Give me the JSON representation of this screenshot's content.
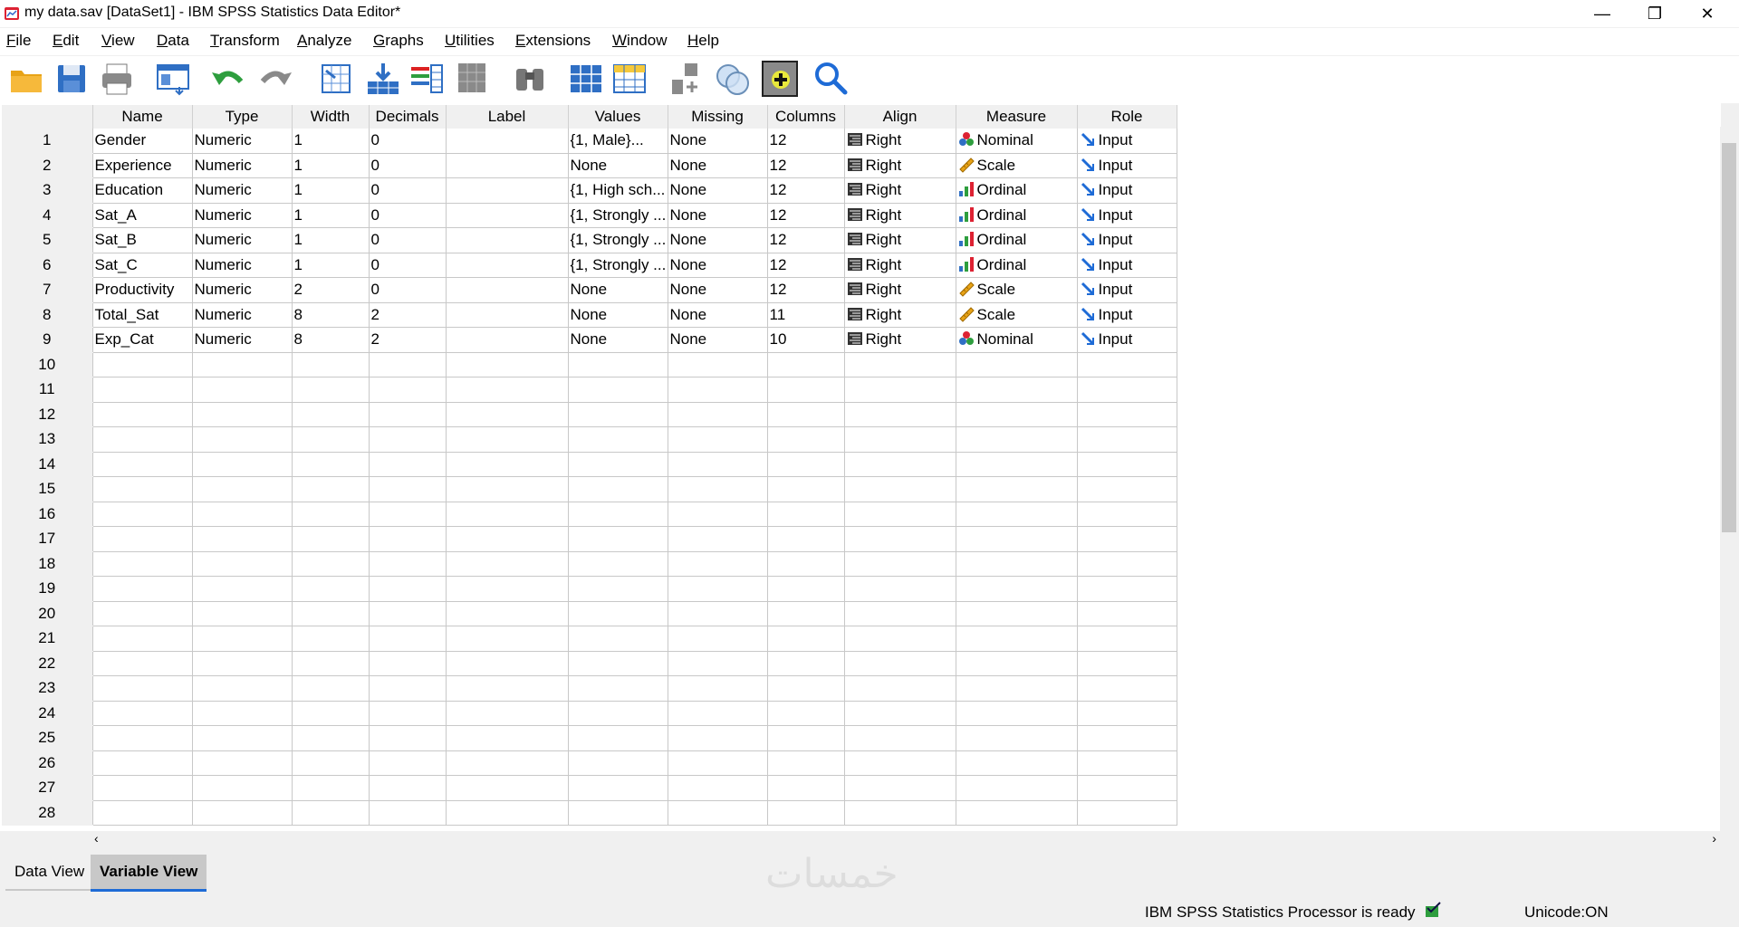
{
  "window": {
    "title": "my data.sav [DataSet1] - IBM SPSS Statistics Data Editor*",
    "minimize_glyph": "—",
    "restore_glyph": "❐",
    "close_glyph": "✕"
  },
  "menu": [
    "File",
    "Edit",
    "View",
    "Data",
    "Transform",
    "Analyze",
    "Graphs",
    "Utilities",
    "Extensions",
    "Window",
    "Help"
  ],
  "toolbar": {
    "icons": [
      "open-folder-icon",
      "save-icon",
      "print-icon",
      "dialog-recall-icon",
      "undo-icon",
      "redo-icon",
      "goto-case-icon",
      "goto-variable-icon",
      "variables-icon",
      "run-descriptives-icon",
      "find-icon",
      "insert-cases-icon",
      "insert-variable-icon",
      "split-file-icon",
      "select-cases-icon",
      "value-labels-icon",
      "use-variable-sets-icon",
      "search-icon"
    ]
  },
  "grid": {
    "columns": [
      "Name",
      "Type",
      "Width",
      "Decimals",
      "Label",
      "Values",
      "Missing",
      "Columns",
      "Align",
      "Measure",
      "Role"
    ],
    "rows": [
      {
        "num": "1",
        "name": "Gender",
        "type": "Numeric",
        "width": "1",
        "decimals": "0",
        "label": "",
        "values": "{1, Male}...",
        "missing": "None",
        "columns": "12",
        "align": "Right",
        "measure": "Nominal",
        "role": "Input"
      },
      {
        "num": "2",
        "name": "Experience",
        "type": "Numeric",
        "width": "1",
        "decimals": "0",
        "label": "",
        "values": "None",
        "missing": "None",
        "columns": "12",
        "align": "Right",
        "measure": "Scale",
        "role": "Input"
      },
      {
        "num": "3",
        "name": "Education",
        "type": "Numeric",
        "width": "1",
        "decimals": "0",
        "label": "",
        "values": "{1, High sch...",
        "missing": "None",
        "columns": "12",
        "align": "Right",
        "measure": "Ordinal",
        "role": "Input"
      },
      {
        "num": "4",
        "name": "Sat_A",
        "type": "Numeric",
        "width": "1",
        "decimals": "0",
        "label": "",
        "values": "{1, Strongly ...",
        "missing": "None",
        "columns": "12",
        "align": "Right",
        "measure": "Ordinal",
        "role": "Input"
      },
      {
        "num": "5",
        "name": "Sat_B",
        "type": "Numeric",
        "width": "1",
        "decimals": "0",
        "label": "",
        "values": "{1, Strongly ...",
        "missing": "None",
        "columns": "12",
        "align": "Right",
        "measure": "Ordinal",
        "role": "Input"
      },
      {
        "num": "6",
        "name": "Sat_C",
        "type": "Numeric",
        "width": "1",
        "decimals": "0",
        "label": "",
        "values": "{1, Strongly ...",
        "missing": "None",
        "columns": "12",
        "align": "Right",
        "measure": "Ordinal",
        "role": "Input"
      },
      {
        "num": "7",
        "name": "Productivity",
        "type": "Numeric",
        "width": "2",
        "decimals": "0",
        "label": "",
        "values": "None",
        "missing": "None",
        "columns": "12",
        "align": "Right",
        "measure": "Scale",
        "role": "Input"
      },
      {
        "num": "8",
        "name": "Total_Sat",
        "type": "Numeric",
        "width": "8",
        "decimals": "2",
        "label": "",
        "values": "None",
        "missing": "None",
        "columns": "11",
        "align": "Right",
        "measure": "Scale",
        "role": "Input"
      },
      {
        "num": "9",
        "name": "Exp_Cat",
        "type": "Numeric",
        "width": "8",
        "decimals": "2",
        "label": "",
        "values": "None",
        "missing": "None",
        "columns": "10",
        "align": "Right",
        "measure": "Nominal",
        "role": "Input"
      }
    ],
    "empty_row_numbers": [
      "10",
      "11",
      "12",
      "13",
      "14",
      "15",
      "16",
      "17",
      "18",
      "19",
      "20",
      "21",
      "22",
      "23",
      "24",
      "25",
      "26",
      "27",
      "28"
    ]
  },
  "tabs": {
    "data_view": "Data View",
    "variable_view": "Variable View",
    "active": "Variable View"
  },
  "status": {
    "processor": "IBM SPSS Statistics Processor is ready",
    "unicode": "Unicode:ON",
    "watermark": "خمسات"
  },
  "colors": {
    "accent_blue": "#1e6bd6",
    "active_tab_underline": "#1e6bd6"
  }
}
